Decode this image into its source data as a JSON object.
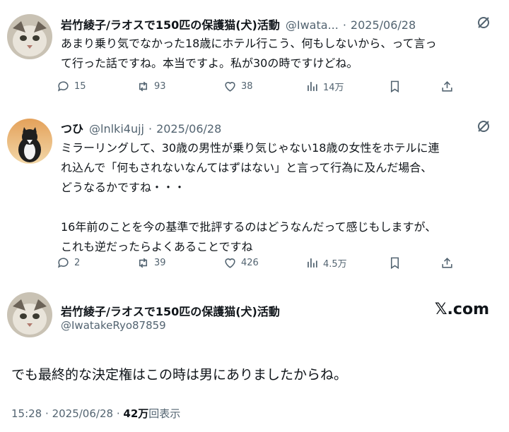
{
  "tweets": [
    {
      "name": "岩竹綾子/ラオスで150匹の保護猫(犬)活動",
      "handle": "@Iwata...",
      "sep": "·",
      "date": "2025/06/28",
      "text_lines": [
        "あまり乗り気でなかった18歳にホテル行こう、何もしないから、って言っ",
        "て行った話ですね。本当ですよ。私が30の時ですけどね。"
      ],
      "replies": "15",
      "retweets": "93",
      "likes": "38",
      "views": "14万"
    },
    {
      "name": "つひ",
      "handle": "@lnlki4ujj",
      "sep": "·",
      "date": "2025/06/28",
      "text_lines": [
        "ミラーリングして、30歳の男性が乗り気じゃない18歳の女性をホテルに連",
        "れ込んで「何もされないなんてはずはない」と言って行為に及んだ場合、",
        "どうなるかですね・・・",
        "",
        "16年前のことを今の基準で批評するのはどうなんだって感じもしますが、",
        "これも逆だったらよくあることですね"
      ],
      "replies": "2",
      "retweets": "39",
      "likes": "426",
      "views": "4.5万"
    }
  ],
  "focus": {
    "name": "岩竹綾子/ラオスで150匹の保護猫(犬)活動",
    "handle": "@IwatakeRyo87859",
    "logo": "𝕏.com",
    "text": "でも最終的な決定権はこの時は男にありましたからね。",
    "time": "15:28",
    "sep": "·",
    "date": "2025/06/28",
    "views_count": "42万",
    "views_label": "回表示"
  },
  "icons": [
    "grok-icon",
    "reply-icon",
    "retweet-icon",
    "like-icon",
    "views-icon",
    "bookmark-icon",
    "share-icon"
  ]
}
